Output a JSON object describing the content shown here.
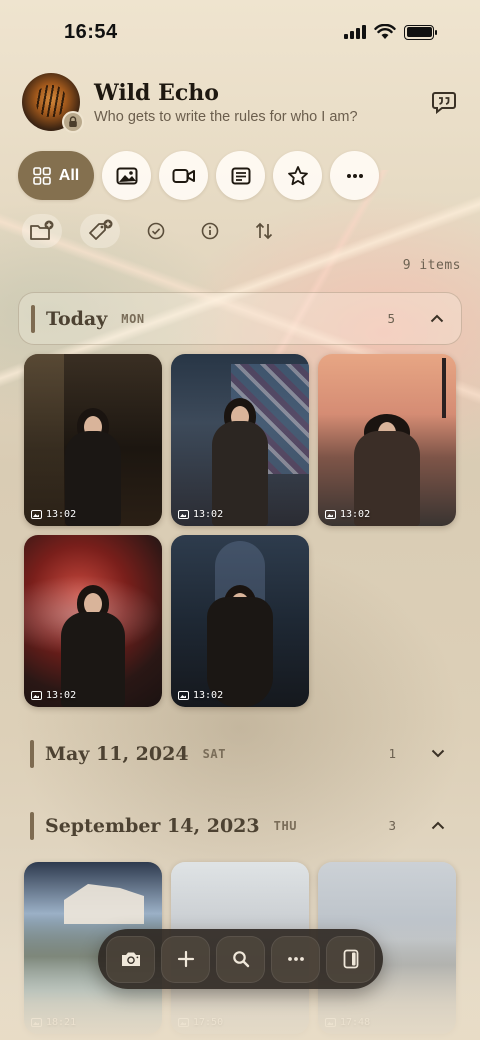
{
  "status_bar": {
    "time": "16:54"
  },
  "profile": {
    "name": "Wild Echo",
    "subtitle": "Who gets to write the rules for who I am?"
  },
  "filters": {
    "all_label": "All"
  },
  "items_count": "9 items",
  "sections": [
    {
      "title": "Today",
      "day": "MON",
      "count": "5",
      "expanded": true
    },
    {
      "title": "May 11, 2024",
      "day": "SAT",
      "count": "1",
      "expanded": false
    },
    {
      "title": "September 14, 2023",
      "day": "THU",
      "count": "3",
      "expanded": true
    }
  ],
  "today_photos": [
    {
      "time": "13:02"
    },
    {
      "time": "13:02"
    },
    {
      "time": "13:02"
    },
    {
      "time": "13:02"
    },
    {
      "time": "13:02"
    }
  ],
  "sept_photos": [
    {
      "time": "18:21"
    },
    {
      "time": "17:50"
    },
    {
      "time": "17:48"
    }
  ],
  "colors": {
    "accent": "#84704f",
    "background": "#e8dcc6",
    "bottom_bar": "#2c2620"
  }
}
